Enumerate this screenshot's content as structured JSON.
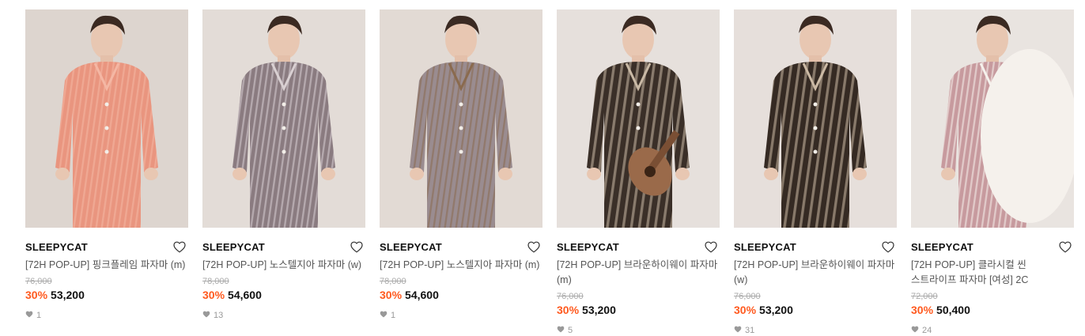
{
  "products": [
    {
      "brand": "SLEEPYCAT",
      "title": "[72H POP-UP] 핑크플레임 파자마 (m)",
      "original_price": "76,000",
      "discount": "30%",
      "price": "53,200",
      "likes": "1",
      "image_colors": {
        "bg": "#ddd5cf",
        "garment": "#e9957f",
        "accent": "#f4b7a4"
      }
    },
    {
      "brand": "SLEEPYCAT",
      "title": "[72H POP-UP] 노스텔지아 파자마 (w)",
      "original_price": "78,000",
      "discount": "30%",
      "price": "54,600",
      "likes": "13",
      "image_colors": {
        "bg": "#e3dcd7",
        "garment": "#8a7b80",
        "accent": "#d9d0d2"
      }
    },
    {
      "brand": "SLEEPYCAT",
      "title": "[72H POP-UP] 노스텔지아 파자마 (m)",
      "original_price": "78,000",
      "discount": "30%",
      "price": "54,600",
      "likes": "1",
      "image_colors": {
        "bg": "#e2dad4",
        "garment": "#9a8c90",
        "accent": "#8a6a4e"
      }
    },
    {
      "brand": "SLEEPYCAT",
      "title": "[72H POP-UP] 브라운하이웨이 파자마 (m)",
      "original_price": "76,000",
      "discount": "30%",
      "price": "53,200",
      "likes": "5",
      "image_colors": {
        "bg": "#e6e0dc",
        "garment": "#3a2f28",
        "accent": "#c9b9a5"
      }
    },
    {
      "brand": "SLEEPYCAT",
      "title": "[72H POP-UP] 브라운하이웨이 파자마 (w)",
      "original_price": "76,000",
      "discount": "30%",
      "price": "53,200",
      "likes": "31",
      "image_colors": {
        "bg": "#e6dfdb",
        "garment": "#352a23",
        "accent": "#cbb9a4"
      }
    },
    {
      "brand": "SLEEPYCAT",
      "title": "[72H POP-UP] 클라시컬 씬 스트라이프 파자마 [여성] 2C",
      "original_price": "72,000",
      "discount": "30%",
      "price": "50,400",
      "likes": "24",
      "image_colors": {
        "bg": "#e9e4e0",
        "garment": "#c79a9e",
        "accent": "#f5f1ec"
      }
    }
  ]
}
